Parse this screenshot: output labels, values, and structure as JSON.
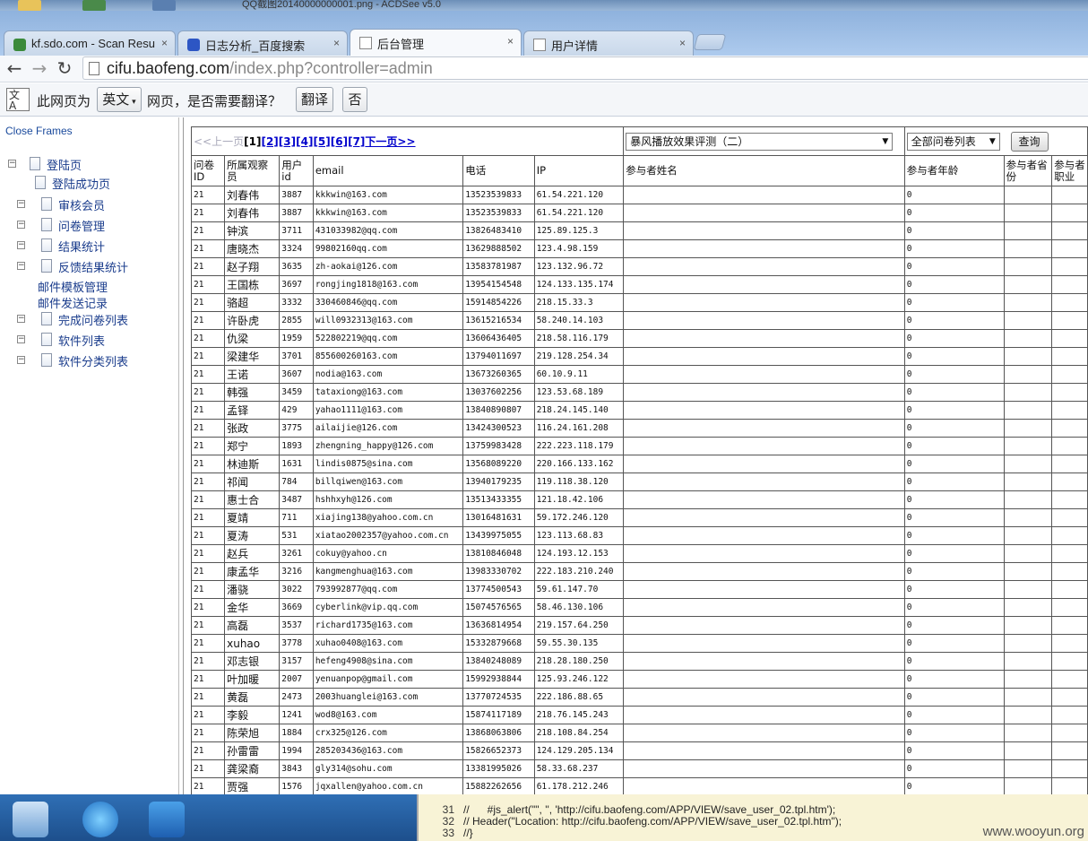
{
  "window_title": "QQ截图20140000000001.png - ACDSee v5.0",
  "tabs": [
    {
      "label": "kf.sdo.com - Scan Resu",
      "close": "×"
    },
    {
      "label": "日志分析_百度搜索",
      "close": "×"
    },
    {
      "label": "后台管理",
      "close": "×"
    },
    {
      "label": "用户详情",
      "close": "×"
    }
  ],
  "nav": {
    "back": "←",
    "forward": "→",
    "reload": "↻"
  },
  "address": {
    "host": "cifu.baofeng.com",
    "path": "/index.php?controller=admin"
  },
  "translate_bar": {
    "icon": "文A",
    "prefix": "此网页为",
    "language": "英文",
    "suffix": "网页，是否需要翻译？",
    "translate_button": "翻译",
    "no_button": "否"
  },
  "left_frame": {
    "close_frames": "Close Frames",
    "tree": [
      {
        "label": "登陆页",
        "expander": "−"
      },
      {
        "label": "登陆成功页"
      },
      {
        "label": "审核会员",
        "expander": "−"
      },
      {
        "label": "问卷管理",
        "expander": "−"
      },
      {
        "label": "结果统计",
        "expander": "−"
      },
      {
        "label": "反馈结果统计",
        "expander": "−"
      },
      {
        "label": "邮件模板管理"
      },
      {
        "label": "邮件发送记录"
      },
      {
        "label": "完成问卷列表",
        "expander": "−"
      },
      {
        "label": "软件列表",
        "expander": "−"
      },
      {
        "label": "软件分类列表",
        "expander": "−"
      }
    ]
  },
  "pager": {
    "prev": "<<上一页",
    "current": "[1]",
    "pages": [
      "[2]",
      "[3]",
      "[4]",
      "[5]",
      "[6]",
      "[7]"
    ],
    "next": "下一页>>"
  },
  "survey_select": "暴风播放效果评测（二）",
  "list_select": "全部问卷列表",
  "query_button": "查询",
  "columns": [
    "问卷ID",
    "所属观察员",
    "用户id",
    "email",
    "电话",
    "IP",
    "参与者姓名",
    "参与者年龄",
    "参与者省份",
    "参与者职业"
  ],
  "rows": [
    [
      "21",
      "刘春伟",
      "3887",
      "kkkwin@163.com",
      "13523539833",
      "61.54.221.120",
      "",
      "0",
      "",
      ""
    ],
    [
      "21",
      "刘春伟",
      "3887",
      "kkkwin@163.com",
      "13523539833",
      "61.54.221.120",
      "",
      "0",
      "",
      ""
    ],
    [
      "21",
      "钟滨",
      "3711",
      "431033982@qq.com",
      "13826483410",
      "125.89.125.3",
      "",
      "0",
      "",
      ""
    ],
    [
      "21",
      "唐晓杰",
      "3324",
      "99802160qq.com",
      "13629888502",
      "123.4.98.159",
      "",
      "0",
      "",
      ""
    ],
    [
      "21",
      "赵子翔",
      "3635",
      "zh-aokai@126.com",
      "13583781987",
      "123.132.96.72",
      "",
      "0",
      "",
      ""
    ],
    [
      "21",
      "王国栋",
      "3697",
      "rongjing1818@163.com",
      "13954154548",
      "124.133.135.174",
      "",
      "0",
      "",
      ""
    ],
    [
      "21",
      "骆超",
      "3332",
      "330460846@qq.com",
      "15914854226",
      "218.15.33.3",
      "",
      "0",
      "",
      ""
    ],
    [
      "21",
      "许卧虎",
      "2855",
      "will0932313@163.com",
      "13615216534",
      "58.240.14.103",
      "",
      "0",
      "",
      ""
    ],
    [
      "21",
      "仇梁",
      "1959",
      "522802219@qq.com",
      "13606436405",
      "218.58.116.179",
      "",
      "0",
      "",
      ""
    ],
    [
      "21",
      "梁建华",
      "3701",
      "855600260163.com",
      "13794011697",
      "219.128.254.34",
      "",
      "0",
      "",
      ""
    ],
    [
      "21",
      "王诺",
      "3607",
      "nodia@163.com",
      "13673260365",
      "60.10.9.11",
      "",
      "0",
      "",
      ""
    ],
    [
      "21",
      "韩强",
      "3459",
      "tataxiong@163.com",
      "13037602256",
      "123.53.68.189",
      "",
      "0",
      "",
      ""
    ],
    [
      "21",
      "孟铎",
      "429",
      "yahao1111@163.com",
      "13840890807",
      "218.24.145.140",
      "",
      "0",
      "",
      ""
    ],
    [
      "21",
      "张政",
      "3775",
      "ailaijie@126.com",
      "13424300523",
      "116.24.161.208",
      "",
      "0",
      "",
      ""
    ],
    [
      "21",
      "郑宁",
      "1893",
      "zhengning_happy@126.com",
      "13759983428",
      "222.223.118.179",
      "",
      "0",
      "",
      ""
    ],
    [
      "21",
      "林迪斯",
      "1631",
      "lindis0875@sina.com",
      "13568089220",
      "220.166.133.162",
      "",
      "0",
      "",
      ""
    ],
    [
      "21",
      "祁闻",
      "784",
      "billqiwen@163.com",
      "13940179235",
      "119.118.38.120",
      "",
      "0",
      "",
      ""
    ],
    [
      "21",
      "惠士合",
      "3487",
      "hshhxyh@126.com",
      "13513433355",
      "121.18.42.106",
      "",
      "0",
      "",
      ""
    ],
    [
      "21",
      "夏靖",
      "711",
      "xiajing138@yahoo.com.cn",
      "13016481631",
      "59.172.246.120",
      "",
      "0",
      "",
      ""
    ],
    [
      "21",
      "夏涛",
      "531",
      "xiatao2002357@yahoo.com.cn",
      "13439975055",
      "123.113.68.83",
      "",
      "0",
      "",
      ""
    ],
    [
      "21",
      "赵兵",
      "3261",
      "cokuy@yahoo.cn",
      "13810846048",
      "124.193.12.153",
      "",
      "0",
      "",
      ""
    ],
    [
      "21",
      "康孟华",
      "3216",
      "kangmenghua@163.com",
      "13983330702",
      "222.183.210.240",
      "",
      "0",
      "",
      ""
    ],
    [
      "21",
      "潘骁",
      "3022",
      "793992877@qq.com",
      "13774500543",
      "59.61.147.70",
      "",
      "0",
      "",
      ""
    ],
    [
      "21",
      "金华",
      "3669",
      "cyberlink@vip.qq.com",
      "15074576565",
      "58.46.130.106",
      "",
      "0",
      "",
      ""
    ],
    [
      "21",
      "高磊",
      "3537",
      "richard1735@163.com",
      "13636814954",
      "219.157.64.250",
      "",
      "0",
      "",
      ""
    ],
    [
      "21",
      "xuhao",
      "3778",
      "xuhao0408@163.com",
      "15332879668",
      "59.55.30.135",
      "",
      "0",
      "",
      ""
    ],
    [
      "21",
      "邓志银",
      "3157",
      "hefeng4908@sina.com",
      "13840248089",
      "218.28.180.250",
      "",
      "0",
      "",
      ""
    ],
    [
      "21",
      "叶加暖",
      "2007",
      "yenuanpop@gmail.com",
      "15992938844",
      "125.93.246.122",
      "",
      "0",
      "",
      ""
    ],
    [
      "21",
      "黄磊",
      "2473",
      "2003huanglei@163.com",
      "13770724535",
      "222.186.88.65",
      "",
      "0",
      "",
      ""
    ],
    [
      "21",
      "李毅",
      "1241",
      "wod8@163.com",
      "15874117189",
      "218.76.145.243",
      "",
      "0",
      "",
      ""
    ],
    [
      "21",
      "陈荣旭",
      "1884",
      "crx325@126.com",
      "13868063806",
      "218.108.84.254",
      "",
      "0",
      "",
      ""
    ],
    [
      "21",
      "孙雷雷",
      "1994",
      "285203436@163.com",
      "15826652373",
      "124.129.205.134",
      "",
      "0",
      "",
      ""
    ],
    [
      "21",
      "龚梁裔",
      "3843",
      "gly314@sohu.com",
      "13381995026",
      "58.33.68.237",
      "",
      "0",
      "",
      ""
    ],
    [
      "21",
      "贾强",
      "1576",
      "jqxallen@yahoo.com.cn",
      "15882262656",
      "61.178.212.246",
      "",
      "0",
      "",
      ""
    ]
  ],
  "code_lines": [
    {
      "num": "31",
      "text": "//      #js_alert(\"\", '', 'http://cifu.baofeng.com/APP/VIEW/save_user_02.tpl.htm');"
    },
    {
      "num": "32",
      "text": "// Header(\"Location: http://cifu.baofeng.com/APP/VIEW/save_user_02.tpl.htm\");"
    },
    {
      "num": "33",
      "text": "//}"
    }
  ],
  "watermark": "www.wooyun.org",
  "colors": {
    "accent_link": "#0000cc",
    "tree_text": "#1a3c8c",
    "taskbar": "#1d4f8c"
  }
}
